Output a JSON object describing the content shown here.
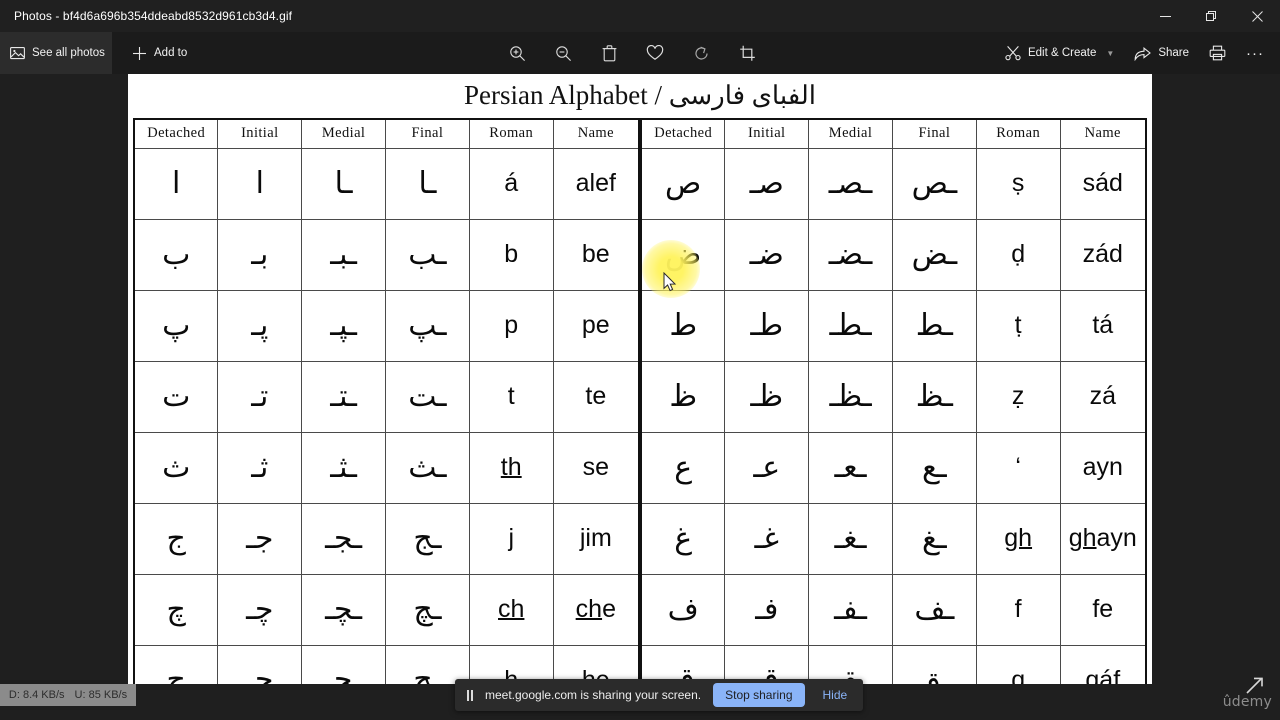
{
  "window": {
    "title": "Photos - bf4d6a696b354ddeabd8532d961cb3d4.gif",
    "minimize_label": "Minimize",
    "restore_label": "Restore",
    "close_label": "Close"
  },
  "toolbar": {
    "see_all_photos": "See all photos",
    "add_to": "Add to",
    "zoom_in": "Zoom in",
    "zoom_out": "Zoom out",
    "delete": "Delete",
    "favorite": "Add to favorites",
    "rotate": "Rotate",
    "crop": "Crop",
    "edit_create": "Edit & Create",
    "share": "Share",
    "print": "Print",
    "more": "···"
  },
  "image": {
    "title_en": "Persian Alphabet",
    "title_sep": "/",
    "title_ar": "الفبای فارسی",
    "headers": [
      "Detached",
      "Initial",
      "Medial",
      "Final",
      "Roman",
      "Name"
    ],
    "left_rows": [
      {
        "detached": "ا",
        "initial": "ا",
        "medial": "ـا",
        "final": "ـا",
        "roman": "á",
        "roman_underline": "",
        "name": "alef",
        "name_underline": ""
      },
      {
        "detached": "ب",
        "initial": "بـ",
        "medial": "ـبـ",
        "final": "ـب",
        "roman": "b",
        "roman_underline": "",
        "name": "be",
        "name_underline": ""
      },
      {
        "detached": "پ",
        "initial": "پـ",
        "medial": "ـپـ",
        "final": "ـپ",
        "roman": "p",
        "roman_underline": "",
        "name": "pe",
        "name_underline": ""
      },
      {
        "detached": "ت",
        "initial": "تـ",
        "medial": "ـتـ",
        "final": "ـت",
        "roman": "t",
        "roman_underline": "",
        "name": "te",
        "name_underline": ""
      },
      {
        "detached": "ث",
        "initial": "ثـ",
        "medial": "ـثـ",
        "final": "ـث",
        "roman": "th",
        "roman_underline": "th",
        "name": "se",
        "name_underline": ""
      },
      {
        "detached": "ج",
        "initial": "جـ",
        "medial": "ـجـ",
        "final": "ـج",
        "roman": "j",
        "roman_underline": "",
        "name": "jim",
        "name_underline": ""
      },
      {
        "detached": "چ",
        "initial": "چـ",
        "medial": "ـچـ",
        "final": "ـچ",
        "roman": "ch",
        "roman_underline": "ch",
        "name": "che",
        "name_underline": "ch"
      },
      {
        "detached": "ح",
        "initial": "حـ",
        "medial": "ـحـ",
        "final": "ـح",
        "roman": "h",
        "roman_underline": "",
        "name": "he",
        "name_underline": ""
      }
    ],
    "right_rows": [
      {
        "detached": "ص",
        "initial": "صـ",
        "medial": "ـصـ",
        "final": "ـص",
        "roman": "ṣ",
        "roman_underline": "",
        "name": "sád",
        "name_underline": ""
      },
      {
        "detached": "ض",
        "initial": "ضـ",
        "medial": "ـضـ",
        "final": "ـض",
        "roman": "ḍ",
        "roman_underline": "",
        "name": "zád",
        "name_underline": ""
      },
      {
        "detached": "ط",
        "initial": "طـ",
        "medial": "ـطـ",
        "final": "ـط",
        "roman": "ṭ",
        "roman_underline": "",
        "name": "tá",
        "name_underline": ""
      },
      {
        "detached": "ظ",
        "initial": "ظـ",
        "medial": "ـظـ",
        "final": "ـظ",
        "roman": "ẓ",
        "roman_underline": "",
        "name": "zá",
        "name_underline": ""
      },
      {
        "detached": "ع",
        "initial": "عـ",
        "medial": "ـعـ",
        "final": "ـع",
        "roman": "‘",
        "roman_underline": "",
        "name": "ayn",
        "name_underline": ""
      },
      {
        "detached": "غ",
        "initial": "غـ",
        "medial": "ـغـ",
        "final": "ـغ",
        "roman": "gh",
        "roman_underline": "gh",
        "name": "ghayn",
        "name_underline": "gh"
      },
      {
        "detached": "ف",
        "initial": "فـ",
        "medial": "ـفـ",
        "final": "ـف",
        "roman": "f",
        "roman_underline": "",
        "name": "fe",
        "name_underline": ""
      },
      {
        "detached": "ق",
        "initial": "قـ",
        "medial": "ـقـ",
        "final": "ـق",
        "roman": "q",
        "roman_underline": "",
        "name": "qáf",
        "name_underline": ""
      }
    ]
  },
  "overlays": {
    "network_down": "D: 8.4 KB/s",
    "network_up": "U: 85 KB/s",
    "share_message": "meet.google.com is sharing your screen.",
    "stop_sharing": "Stop sharing",
    "hide": "Hide",
    "watermark": "ûdemy"
  },
  "colors": {
    "accent_blue": "#8ab4f8",
    "highlight_yellow": "#fff35c",
    "window_bg": "#1f1f1f",
    "sheet_bg": "#ffffff"
  }
}
